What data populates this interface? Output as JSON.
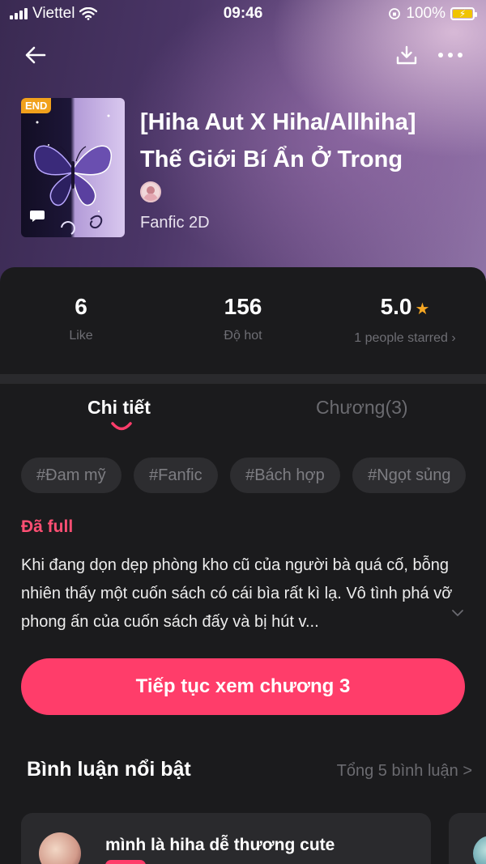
{
  "status_bar": {
    "carrier": "Viettel",
    "time": "09:46",
    "battery": "100%"
  },
  "story": {
    "cover_badge": "END",
    "title": "[Hiha Aut X Hiha/Allhiha] Thế Giới Bí Ẩn Ở Trong",
    "category": "Fanfic 2D"
  },
  "stats": [
    {
      "value": "6",
      "label": "Like"
    },
    {
      "value": "156",
      "label": "Độ hot"
    },
    {
      "value": "5.0",
      "label": "1 people starred"
    }
  ],
  "tabs": [
    {
      "label": "Chi tiết",
      "active": true
    },
    {
      "label": "Chương(3)",
      "active": false
    }
  ],
  "tags": [
    "#Đam mỹ",
    "#Fanfic",
    "#Bách hợp",
    "#Ngọt sủng"
  ],
  "details": {
    "status": "Đã full",
    "synopsis": "Khi đang dọn dẹp phòng kho cũ của người bà quá cố, bỗng nhiên thấy một cuốn sách có cái bìa rất kì lạ. Vô tình phá vỡ phong ấn của cuốn sách đấy và bị hút v..."
  },
  "continue_button": "Tiếp tục xem chương 3",
  "comments": {
    "title": "Bình luận nổi bật",
    "total": "Tổng 5 bình luận >",
    "items": [
      {
        "name": "mình là hiha dễ thương cute"
      }
    ]
  },
  "colors": {
    "accent": "#ff3d6a",
    "status_full": "#ff4f73",
    "star": "#f5a623",
    "end_badge": "#f1a11c",
    "background": "#1b1b1d"
  },
  "icons": [
    "back-arrow-icon",
    "download-icon",
    "more-icon",
    "chat-bubble-icon",
    "star-icon",
    "chevron-right-icon",
    "chevron-down-icon",
    "wifi-icon",
    "signal-icon",
    "battery-icon"
  ]
}
